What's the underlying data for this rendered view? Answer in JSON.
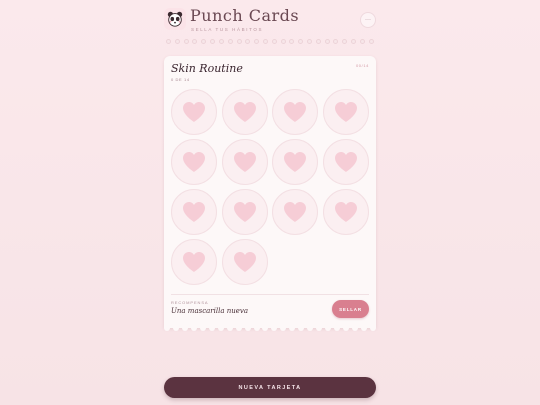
{
  "header": {
    "title": "Punch Cards",
    "subtitle": "SELLA TUS HÁBITOS",
    "menu_label": "···",
    "logo_icon": "panda-icon"
  },
  "card": {
    "title": "Skin Routine",
    "count": "0 DE 14",
    "progress": "00/14",
    "total_slots": 14,
    "stamped_slots": 0,
    "slot_icon": "heart-icon",
    "reward_label": "RECOMPENSA",
    "reward_value": "Una mascarilla nueva",
    "stamp_button_label": "SELLAR"
  },
  "footer": {
    "new_card_label": "NUEVA TARJETA"
  },
  "colors": {
    "accent": "#d97f8f",
    "primary_button": "#5b3340",
    "heart": "#f6cdd6",
    "background": "#fbe9ec"
  }
}
